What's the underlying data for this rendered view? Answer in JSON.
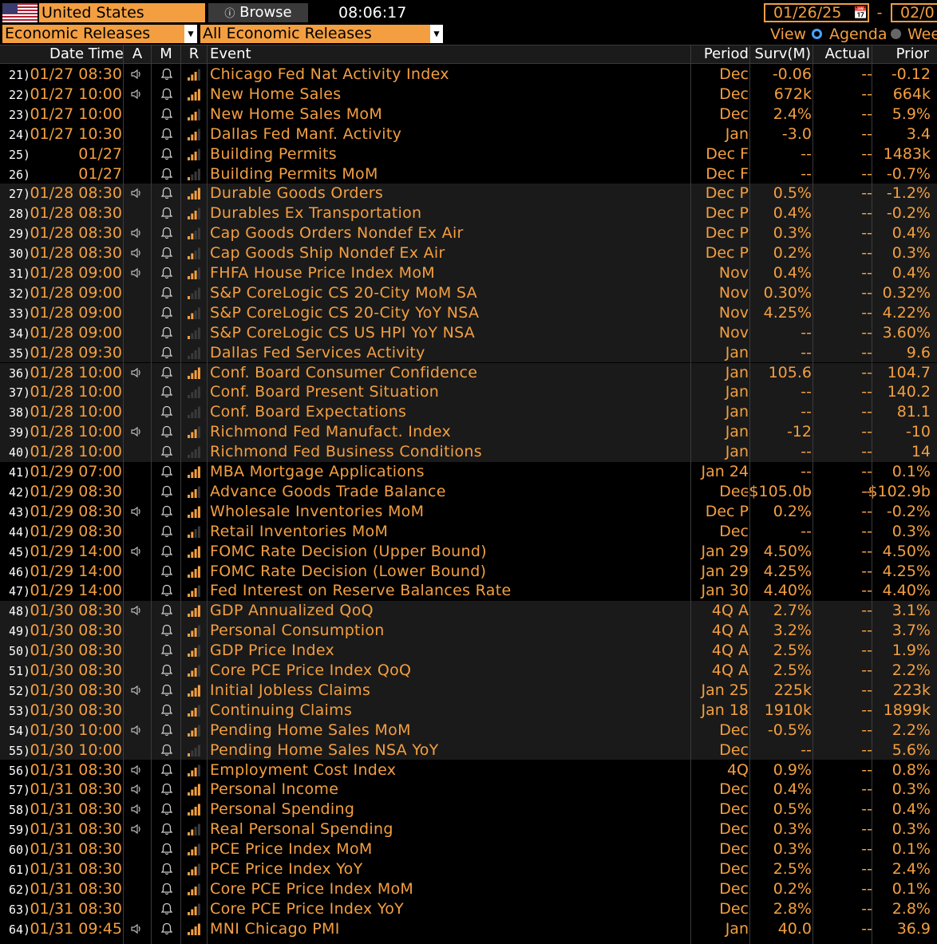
{
  "top": {
    "country": "United States",
    "browse": "Browse",
    "time": "08:06:17",
    "date_from": "01/26/25",
    "date_sep": "-",
    "date_to": "02/0",
    "category": "Economic Releases",
    "filter": "All Economic Releases",
    "view_label": "View",
    "agenda_label": "Agenda",
    "week_label": "Wee"
  },
  "columns": {
    "datetime": "Date Time",
    "a": "A",
    "m": "M",
    "r": "R",
    "event": "Event",
    "period": "Period",
    "surv": "Surv(M)",
    "actual": "Actual",
    "prior": "Prior"
  },
  "colors": {
    "accent": "#f39f41",
    "shade": "#1a1a1a",
    "bar_dim": "#3a3a3a"
  },
  "rows": [
    {
      "n": "21)",
      "dt": "01/27 08:30",
      "ev": "Chicago Fed Nat Activity Index",
      "per": "Dec",
      "surv": "-0.06",
      "act": "--",
      "pri": "-0.12",
      "spk": true,
      "r": 3,
      "shade": false
    },
    {
      "n": "22)",
      "dt": "01/27 10:00",
      "ev": "New Home Sales",
      "per": "Dec",
      "surv": "672k",
      "act": "--",
      "pri": "664k",
      "spk": true,
      "r": 4,
      "shade": false
    },
    {
      "n": "23)",
      "dt": "01/27 10:00",
      "ev": "New Home Sales MoM",
      "per": "Dec",
      "surv": "2.4%",
      "act": "--",
      "pri": "5.9%",
      "spk": false,
      "r": 3,
      "shade": false
    },
    {
      "n": "24)",
      "dt": "01/27 10:30",
      "ev": "Dallas Fed Manf. Activity",
      "per": "Jan",
      "surv": "-3.0",
      "act": "--",
      "pri": "3.4",
      "spk": false,
      "r": 3,
      "shade": false
    },
    {
      "n": "25)",
      "dt": "01/27",
      "ev": "Building Permits",
      "per": "Dec F",
      "surv": "--",
      "act": "--",
      "pri": "1483k",
      "spk": false,
      "r": 3,
      "shade": false
    },
    {
      "n": "26)",
      "dt": "01/27",
      "ev": "Building Permits MoM",
      "per": "Dec F",
      "surv": "--",
      "act": "--",
      "pri": "-0.7%",
      "spk": false,
      "r": 1,
      "shade": false
    },
    {
      "n": "27)",
      "dt": "01/28 08:30",
      "ev": "Durable Goods Orders",
      "per": "Dec P",
      "surv": "0.5%",
      "act": "--",
      "pri": "-1.2%",
      "spk": true,
      "r": 4,
      "shade": true
    },
    {
      "n": "28)",
      "dt": "01/28 08:30",
      "ev": "Durables Ex Transportation",
      "per": "Dec P",
      "surv": "0.4%",
      "act": "--",
      "pri": "-0.2%",
      "spk": false,
      "r": 3,
      "shade": true
    },
    {
      "n": "29)",
      "dt": "01/28 08:30",
      "ev": "Cap Goods Orders Nondef Ex Air",
      "per": "Dec P",
      "surv": "0.3%",
      "act": "--",
      "pri": "0.4%",
      "spk": true,
      "r": 2,
      "shade": true
    },
    {
      "n": "30)",
      "dt": "01/28 08:30",
      "ev": "Cap Goods Ship Nondef Ex Air",
      "per": "Dec P",
      "surv": "0.2%",
      "act": "--",
      "pri": "0.3%",
      "spk": true,
      "r": 2,
      "shade": true
    },
    {
      "n": "31)",
      "dt": "01/28 09:00",
      "ev": "FHFA House Price Index MoM",
      "per": "Nov",
      "surv": "0.4%",
      "act": "--",
      "pri": "0.4%",
      "spk": true,
      "r": 3,
      "shade": true
    },
    {
      "n": "32)",
      "dt": "01/28 09:00",
      "ev": "S&P CoreLogic CS 20-City MoM SA",
      "per": "Nov",
      "surv": "0.30%",
      "act": "--",
      "pri": "0.32%",
      "spk": false,
      "r": 1,
      "shade": true
    },
    {
      "n": "33)",
      "dt": "01/28 09:00",
      "ev": "S&P CoreLogic CS 20-City YoY NSA",
      "per": "Nov",
      "surv": "4.25%",
      "act": "--",
      "pri": "4.22%",
      "spk": false,
      "r": 2,
      "shade": true
    },
    {
      "n": "34)",
      "dt": "01/28 09:00",
      "ev": "S&P CoreLogic CS US HPI YoY NSA",
      "per": "Nov",
      "surv": "--",
      "act": "--",
      "pri": "3.60%",
      "spk": false,
      "r": 1,
      "shade": true
    },
    {
      "n": "35)",
      "dt": "01/28 09:30",
      "ev": "Dallas Fed Services Activity",
      "per": "Jan",
      "surv": "--",
      "act": "--",
      "pri": "9.6",
      "spk": false,
      "r": 0,
      "shade": true
    },
    {
      "n": "36)",
      "dt": "01/28 10:00",
      "ev": "Conf. Board Consumer Confidence",
      "per": "Jan",
      "surv": "105.6",
      "act": "--",
      "pri": "104.7",
      "spk": true,
      "r": 4,
      "shade": true
    },
    {
      "n": "37)",
      "dt": "01/28 10:00",
      "ev": "Conf. Board Present Situation",
      "per": "Jan",
      "surv": "--",
      "act": "--",
      "pri": "140.2",
      "spk": false,
      "r": 0,
      "shade": true
    },
    {
      "n": "38)",
      "dt": "01/28 10:00",
      "ev": "Conf. Board Expectations",
      "per": "Jan",
      "surv": "--",
      "act": "--",
      "pri": "81.1",
      "spk": false,
      "r": 0,
      "shade": true
    },
    {
      "n": "39)",
      "dt": "01/28 10:00",
      "ev": "Richmond Fed Manufact. Index",
      "per": "Jan",
      "surv": "-12",
      "act": "--",
      "pri": "-10",
      "spk": true,
      "r": 3,
      "shade": true
    },
    {
      "n": "40)",
      "dt": "01/28 10:00",
      "ev": "Richmond Fed Business Conditions",
      "per": "Jan",
      "surv": "--",
      "act": "--",
      "pri": "14",
      "spk": false,
      "r": 0,
      "shade": true
    },
    {
      "n": "41)",
      "dt": "01/29 07:00",
      "ev": "MBA Mortgage Applications",
      "per": "Jan 24",
      "surv": "--",
      "act": "--",
      "pri": "0.1%",
      "spk": false,
      "r": 4,
      "shade": false
    },
    {
      "n": "42)",
      "dt": "01/29 08:30",
      "ev": "Advance Goods Trade Balance",
      "per": "Dec",
      "surv": "-$105.0b",
      "act": "--",
      "pri": "-$102.9b",
      "spk": false,
      "r": 3,
      "shade": false
    },
    {
      "n": "43)",
      "dt": "01/29 08:30",
      "ev": "Wholesale Inventories MoM",
      "per": "Dec P",
      "surv": "0.2%",
      "act": "--",
      "pri": "-0.2%",
      "spk": true,
      "r": 4,
      "shade": false
    },
    {
      "n": "44)",
      "dt": "01/29 08:30",
      "ev": "Retail Inventories MoM",
      "per": "Dec",
      "surv": "--",
      "act": "--",
      "pri": "0.3%",
      "spk": false,
      "r": 2,
      "shade": false
    },
    {
      "n": "45)",
      "dt": "01/29 14:00",
      "ev": "FOMC Rate Decision (Upper Bound)",
      "per": "Jan 29",
      "surv": "4.50%",
      "act": "--",
      "pri": "4.50%",
      "spk": true,
      "r": 4,
      "shade": false
    },
    {
      "n": "46)",
      "dt": "01/29 14:00",
      "ev": "FOMC Rate Decision (Lower Bound)",
      "per": "Jan 29",
      "surv": "4.25%",
      "act": "--",
      "pri": "4.25%",
      "spk": false,
      "r": 4,
      "shade": false
    },
    {
      "n": "47)",
      "dt": "01/29 14:00",
      "ev": "Fed Interest on Reserve Balances Rate",
      "per": "Jan 30",
      "surv": "4.40%",
      "act": "--",
      "pri": "4.40%",
      "spk": false,
      "r": 3,
      "shade": false
    },
    {
      "n": "48)",
      "dt": "01/30 08:30",
      "ev": "GDP Annualized QoQ",
      "per": "4Q A",
      "surv": "2.7%",
      "act": "--",
      "pri": "3.1%",
      "spk": true,
      "r": 4,
      "shade": true
    },
    {
      "n": "49)",
      "dt": "01/30 08:30",
      "ev": "Personal Consumption",
      "per": "4Q A",
      "surv": "3.2%",
      "act": "--",
      "pri": "3.7%",
      "spk": false,
      "r": 3,
      "shade": true
    },
    {
      "n": "50)",
      "dt": "01/30 08:30",
      "ev": "GDP Price Index",
      "per": "4Q A",
      "surv": "2.5%",
      "act": "--",
      "pri": "1.9%",
      "spk": false,
      "r": 3,
      "shade": true
    },
    {
      "n": "51)",
      "dt": "01/30 08:30",
      "ev": "Core PCE Price Index QoQ",
      "per": "4Q A",
      "surv": "2.5%",
      "act": "--",
      "pri": "2.2%",
      "spk": false,
      "r": 3,
      "shade": true
    },
    {
      "n": "52)",
      "dt": "01/30 08:30",
      "ev": "Initial Jobless Claims",
      "per": "Jan 25",
      "surv": "225k",
      "act": "--",
      "pri": "223k",
      "spk": true,
      "r": 4,
      "shade": true
    },
    {
      "n": "53)",
      "dt": "01/30 08:30",
      "ev": "Continuing Claims",
      "per": "Jan 18",
      "surv": "1910k",
      "act": "--",
      "pri": "1899k",
      "spk": false,
      "r": 3,
      "shade": true
    },
    {
      "n": "54)",
      "dt": "01/30 10:00",
      "ev": "Pending Home Sales MoM",
      "per": "Dec",
      "surv": "-0.5%",
      "act": "--",
      "pri": "2.2%",
      "spk": true,
      "r": 3,
      "shade": true
    },
    {
      "n": "55)",
      "dt": "01/30 10:00",
      "ev": "Pending Home Sales NSA YoY",
      "per": "Dec",
      "surv": "--",
      "act": "--",
      "pri": "5.6%",
      "spk": false,
      "r": 1,
      "shade": true
    },
    {
      "n": "56)",
      "dt": "01/31 08:30",
      "ev": "Employment Cost Index",
      "per": "4Q",
      "surv": "0.9%",
      "act": "--",
      "pri": "0.8%",
      "spk": true,
      "r": 3,
      "shade": false
    },
    {
      "n": "57)",
      "dt": "01/31 08:30",
      "ev": "Personal Income",
      "per": "Dec",
      "surv": "0.4%",
      "act": "--",
      "pri": "0.3%",
      "spk": true,
      "r": 4,
      "shade": false
    },
    {
      "n": "58)",
      "dt": "01/31 08:30",
      "ev": "Personal Spending",
      "per": "Dec",
      "surv": "0.5%",
      "act": "--",
      "pri": "0.4%",
      "spk": true,
      "r": 4,
      "shade": false
    },
    {
      "n": "59)",
      "dt": "01/31 08:30",
      "ev": "Real Personal Spending",
      "per": "Dec",
      "surv": "0.3%",
      "act": "--",
      "pri": "0.3%",
      "spk": true,
      "r": 2,
      "shade": false
    },
    {
      "n": "60)",
      "dt": "01/31 08:30",
      "ev": "PCE Price Index MoM",
      "per": "Dec",
      "surv": "0.3%",
      "act": "--",
      "pri": "0.1%",
      "spk": false,
      "r": 3,
      "shade": false
    },
    {
      "n": "61)",
      "dt": "01/31 08:30",
      "ev": "PCE Price Index YoY",
      "per": "Dec",
      "surv": "2.5%",
      "act": "--",
      "pri": "2.4%",
      "spk": false,
      "r": 3,
      "shade": false
    },
    {
      "n": "62)",
      "dt": "01/31 08:30",
      "ev": "Core PCE Price Index MoM",
      "per": "Dec",
      "surv": "0.2%",
      "act": "--",
      "pri": "0.1%",
      "spk": false,
      "r": 3,
      "shade": false
    },
    {
      "n": "63)",
      "dt": "01/31 08:30",
      "ev": "Core PCE Price Index YoY",
      "per": "Dec",
      "surv": "2.8%",
      "act": "--",
      "pri": "2.8%",
      "spk": false,
      "r": 3,
      "shade": false
    },
    {
      "n": "64)",
      "dt": "01/31 09:45",
      "ev": "MNI Chicago PMI",
      "per": "Jan",
      "surv": "40.0",
      "act": "--",
      "pri": "36.9",
      "spk": true,
      "r": 4,
      "shade": false
    }
  ]
}
